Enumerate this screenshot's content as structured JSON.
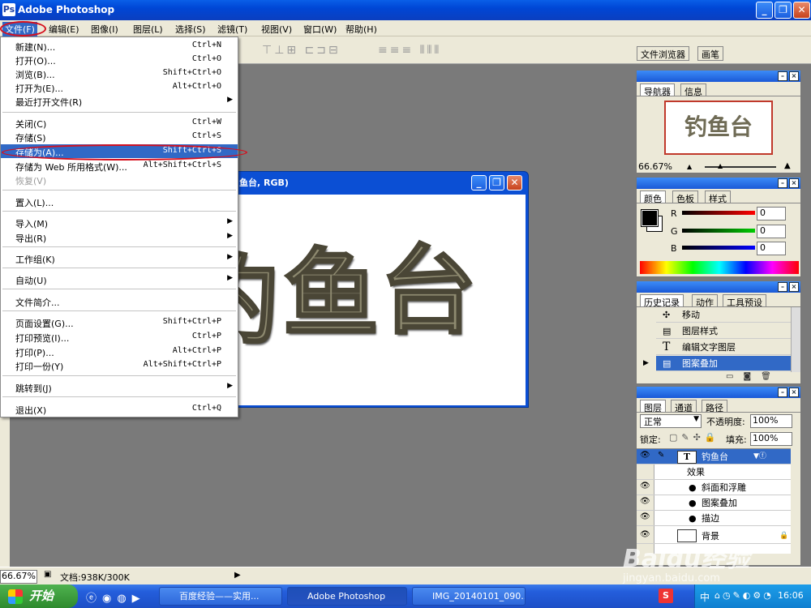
{
  "window": {
    "title": "Adobe Photoshop",
    "icon": "Ps"
  },
  "menubar": [
    "文件(F)",
    "编辑(E)",
    "图像(I)",
    "图层(L)",
    "选择(S)",
    "滤镜(T)",
    "视图(V)",
    "窗口(W)",
    "帮助(H)"
  ],
  "file_menu": {
    "items": [
      {
        "label": "新建(N)...",
        "shortcut": "Ctrl+N"
      },
      {
        "label": "打开(O)...",
        "shortcut": "Ctrl+O"
      },
      {
        "label": "浏览(B)...",
        "shortcut": "Shift+Ctrl+O"
      },
      {
        "label": "打开为(E)...",
        "shortcut": "Alt+Ctrl+O"
      },
      {
        "label": "最近打开文件(R)",
        "shortcut": "",
        "submenu": true
      },
      {
        "label": "关闭(C)",
        "shortcut": "Ctrl+W"
      },
      {
        "label": "存储(S)",
        "shortcut": "Ctrl+S"
      },
      {
        "label": "存储为(A)...",
        "shortcut": "Shift+Ctrl+S",
        "highlighted": true
      },
      {
        "label": "存储为 Web 所用格式(W)...",
        "shortcut": "Alt+Shift+Ctrl+S"
      },
      {
        "label": "恢复(V)",
        "shortcut": "",
        "disabled": true
      },
      {
        "label": "置入(L)...",
        "shortcut": ""
      },
      {
        "label": "导入(M)",
        "shortcut": "",
        "submenu": true
      },
      {
        "label": "导出(R)",
        "shortcut": "",
        "submenu": true
      },
      {
        "label": "工作组(K)",
        "shortcut": "",
        "submenu": true
      },
      {
        "label": "自动(U)",
        "shortcut": "",
        "submenu": true
      },
      {
        "label": "文件简介...",
        "shortcut": ""
      },
      {
        "label": "页面设置(G)...",
        "shortcut": "Shift+Ctrl+P"
      },
      {
        "label": "打印预览(I)...",
        "shortcut": "Ctrl+P"
      },
      {
        "label": "打印(P)...",
        "shortcut": "Alt+Ctrl+P"
      },
      {
        "label": "打印一份(Y)",
        "shortcut": "Alt+Shift+Ctrl+P"
      },
      {
        "label": "跳转到(J)",
        "shortcut": "",
        "submenu": true
      },
      {
        "label": "退出(X)",
        "shortcut": "Ctrl+Q"
      }
    ]
  },
  "options_tabs": {
    "browser": "文件浏览器",
    "brushes": "画笔"
  },
  "document": {
    "title": "鱼台, RGB)",
    "text": "钓鱼台"
  },
  "navigator": {
    "tabs": [
      "导航器",
      "信息"
    ],
    "preview_text": "钓鱼台",
    "zoom": "66.67%"
  },
  "color_panel": {
    "tabs": [
      "颜色",
      "色板",
      "样式"
    ],
    "r_label": "R",
    "g_label": "G",
    "b_label": "B",
    "r": "0",
    "g": "0",
    "b": "0"
  },
  "history": {
    "tabs": [
      "历史记录",
      "动作",
      "工具预设"
    ],
    "items": [
      "移动",
      "图层样式",
      "编辑文字图层",
      "图案叠加"
    ]
  },
  "layers": {
    "tabs": [
      "图层",
      "通道",
      "路径"
    ],
    "blend_mode": "正常",
    "opacity_label": "不透明度:",
    "opacity": "100%",
    "lock_label": "锁定:",
    "fill_label": "填充:",
    "fill": "100%",
    "text_layer": "钓鱼台",
    "effects_label": "效果",
    "effects": [
      "斜面和浮雕",
      "图案叠加",
      "描边"
    ],
    "background": "背景"
  },
  "statusbar": {
    "zoom": "66.67%",
    "doc_info": "文档:938K/300K"
  },
  "taskbar": {
    "start": "开始",
    "buttons": [
      "百度经验——实用...",
      "Adobe Photoshop",
      "IMG_20140101_090..."
    ],
    "clock": "16:06",
    "ime": "中"
  },
  "watermark": {
    "line1": "Baidu经验",
    "line2": "jingyan.baidu.com"
  }
}
